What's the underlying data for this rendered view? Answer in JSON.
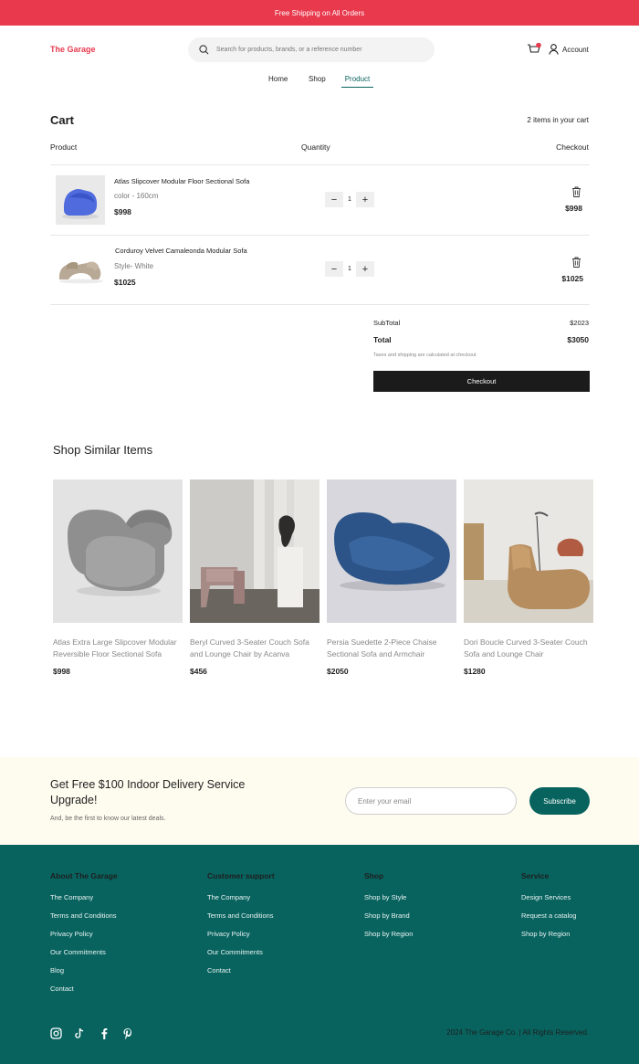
{
  "banner": {
    "text": "Free Shipping on All Orders"
  },
  "header": {
    "logo": "The Garage",
    "search_placeholder": "Search for products, brands, or a reference number",
    "account": "Account",
    "nav": [
      "Home",
      "Shop",
      "Product"
    ],
    "active_nav": "Product"
  },
  "cart": {
    "title": "Cart",
    "count": "2 items in your cart",
    "columns": {
      "product": "Product",
      "quantity": "Quantity",
      "checkout": "Checkout"
    },
    "items": [
      {
        "name": "Atlas Slipcover Modular Floor Sectional Sofa",
        "variant": "color - 160cm",
        "price": "$998",
        "qty": "1",
        "line_price": "$998"
      },
      {
        "name": "Corduroy Velvet Camaleonda Modular Sofa",
        "variant": "Style- White",
        "price": "$1025",
        "qty": "1",
        "line_price": "$1025"
      }
    ],
    "subtotal_label": "SubTotal",
    "subtotal": "$2023",
    "total_label": "Total",
    "total": "$3050",
    "note": "Taxes and shipping are calculated at checkout",
    "checkout_label": "Checkout"
  },
  "similar": {
    "title": "Shop Similar Items",
    "items": [
      {
        "name": "Atlas Extra Large Slipcover Modular Reversible Floor Sectional Sofa",
        "price": "$998"
      },
      {
        "name": "Beryl Curved 3-Seater Couch Sofa and Lounge Chair by Acanva",
        "price": "$456"
      },
      {
        "name": "Persia Suedette 2-Piece Chaise Sectional Sofa and Armchair",
        "price": "$2050"
      },
      {
        "name": "Dori Boucle Curved 3-Seater Couch Sofa and Lounge Chair",
        "price": "$1280"
      }
    ]
  },
  "promo": {
    "heading": "Get Free $100 Indoor Delivery Service Upgrade!",
    "subtext": "And, be the first to know our latest deals.",
    "email_placeholder": "Enter your email",
    "button": "Subscribe"
  },
  "footer": {
    "columns": [
      {
        "title": "About The Garage",
        "links": [
          "The Company",
          "Terms and Conditions",
          "Privacy Policy",
          "Our Commitments",
          "Blog",
          "Contact"
        ]
      },
      {
        "title": "Customer support",
        "links": [
          "The Company",
          "Terms and Conditions",
          "Privacy Policy",
          "Our Commitments",
          "Contact"
        ]
      },
      {
        "title": "Shop",
        "links": [
          "Shop by Style",
          "Shop by Brand",
          "Shop by Region"
        ]
      },
      {
        "title": "Service",
        "links": [
          "Design Services",
          "Request a catalog",
          "Shop by Region"
        ]
      }
    ],
    "social": [
      "instagram-icon",
      "tiktok-icon",
      "facebook-icon",
      "pinterest-icon"
    ],
    "copyright": "2024 The Garage Co. | All Rights Reserved."
  },
  "colors": {
    "brand_red": "#e8394d",
    "brand_teal": "#08635f",
    "promo_bg": "#fefcef"
  }
}
